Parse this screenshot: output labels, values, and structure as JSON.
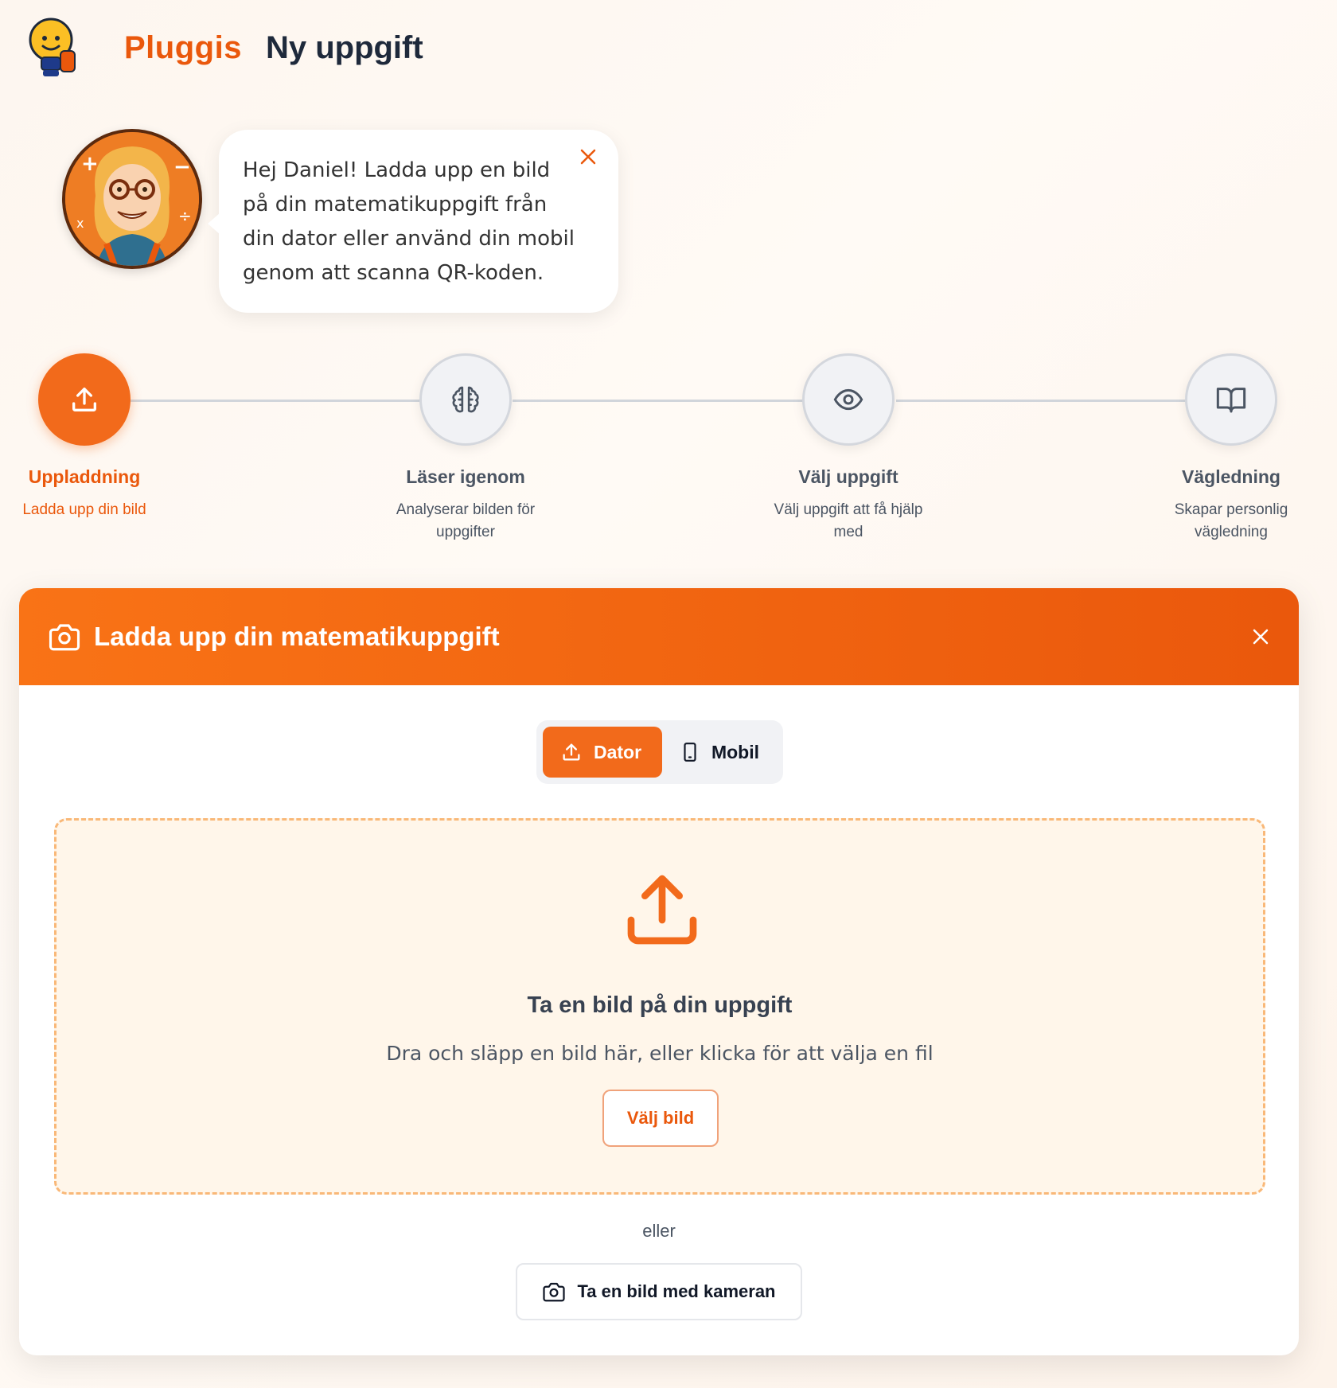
{
  "header": {
    "brand": "Pluggis",
    "title": "Ny uppgift"
  },
  "tutor": {
    "message": "Hej Daniel! Ladda upp en bild på din matematikuppgift från din dator eller använd din mobil genom att scanna QR-koden."
  },
  "steps": [
    {
      "title": "Uppladdning",
      "subtitle": "Ladda upp din bild",
      "icon": "upload-icon",
      "active": true
    },
    {
      "title": "Läser igenom",
      "subtitle": "Analyserar bilden för uppgifter",
      "icon": "brain-icon",
      "active": false
    },
    {
      "title": "Välj uppgift",
      "subtitle": "Välj uppgift att få hjälp med",
      "icon": "eye-icon",
      "active": false
    },
    {
      "title": "Vägledning",
      "subtitle": "Skapar personlig vägledning",
      "icon": "book-icon",
      "active": false
    }
  ],
  "upload_card": {
    "title": "Ladda upp din matematikuppgift",
    "toggle": {
      "dator": "Dator",
      "mobil": "Mobil",
      "selected": "Dator"
    },
    "dropzone": {
      "title": "Ta en bild på din uppgift",
      "description": "Dra och släpp en bild här, eller klicka för att välja en fil",
      "button": "Välj bild"
    },
    "or": "eller",
    "camera_button": "Ta en bild med kameran"
  },
  "colors": {
    "accent": "#f26a1b",
    "accent_dark": "#ea580c",
    "dropzone_bg": "#fff6ea",
    "dropzone_border": "#f9b878"
  }
}
